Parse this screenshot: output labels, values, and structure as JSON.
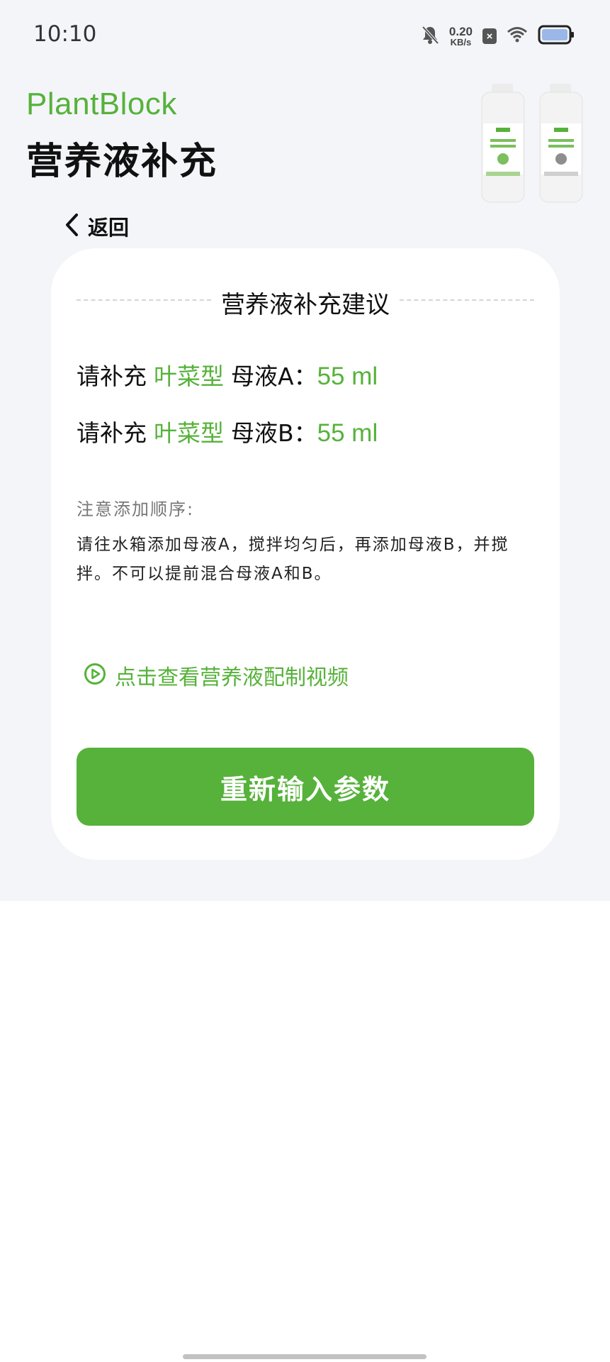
{
  "status_bar": {
    "time": "10:10",
    "net_speed_value": "0.20",
    "net_speed_unit": "KB/s",
    "icons": [
      "bell-muted-icon",
      "x-box-icon",
      "wifi-icon",
      "battery-icon"
    ]
  },
  "header": {
    "brand": "PlantBlock",
    "title": "营养液补充",
    "product_image": "nutrient-bottles-a-b"
  },
  "back": {
    "label": "返回",
    "icon": "chevron-left-icon"
  },
  "card": {
    "title": "营养液补充建议",
    "rows": [
      {
        "prefix": "请补充",
        "type": "叶菜型",
        "solution": "母液A：",
        "amount": "55 ml"
      },
      {
        "prefix": "请补充",
        "type": "叶菜型",
        "solution": "母液B：",
        "amount": "55 ml"
      }
    ],
    "note_title": "注意添加顺序:",
    "note_text": "请往水箱添加母液A，搅拌均匀后，再添加母液B，并搅拌。不可以提前混合母液A和B。",
    "video_link": "点击查看营养液配制视频",
    "button": "重新输入参数"
  },
  "colors": {
    "accent": "#56b23a",
    "background": "#f4f5f9",
    "card": "#ffffff"
  }
}
